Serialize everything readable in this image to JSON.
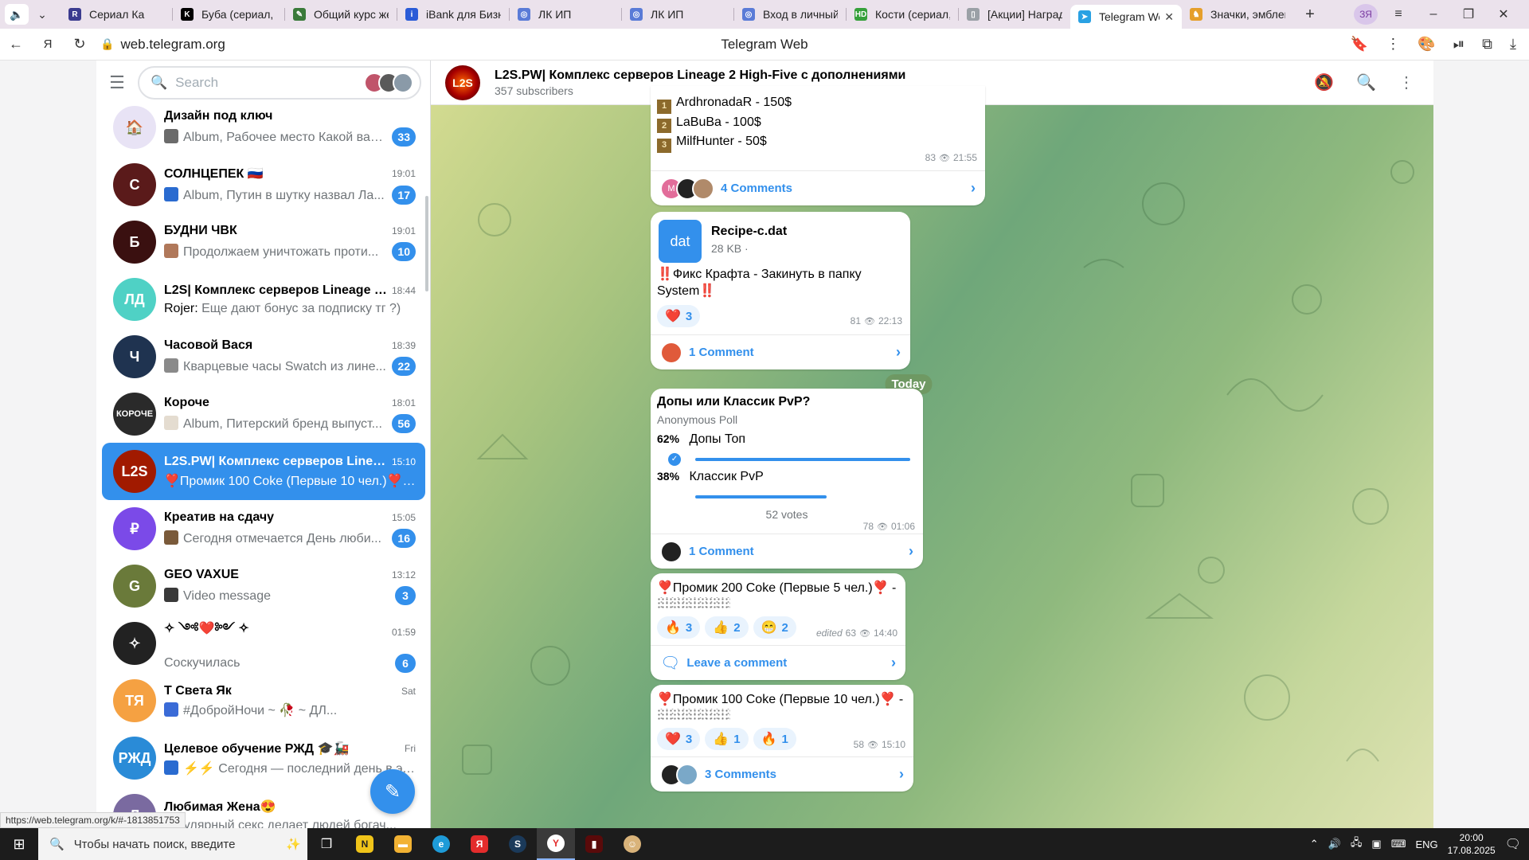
{
  "browser": {
    "tabs": [
      {
        "title": "Сериал Ка",
        "color": "#3b3b8f",
        "glyph": "R"
      },
      {
        "title": "Буба (сериал, в",
        "color": "#000000",
        "glyph": "K"
      },
      {
        "title": "Общий курс же",
        "color": "#3a7a3a",
        "glyph": "✎"
      },
      {
        "title": "iBank для Бизне",
        "color": "#2a5bd7",
        "glyph": "i"
      },
      {
        "title": "ЛК ИП",
        "color": "#5a7bd7",
        "glyph": "◎"
      },
      {
        "title": "ЛК ИП",
        "color": "#5a7bd7",
        "glyph": "◎"
      },
      {
        "title": "Вход в личный",
        "color": "#5a7bd7",
        "glyph": "◎"
      },
      {
        "title": "Кости (сериал,",
        "color": "#35a03a",
        "glyph": "HD"
      },
      {
        "title": "[Акции] Наград",
        "color": "#9aa0a6",
        "glyph": "▯"
      },
      {
        "title": "Telegram We",
        "color": "#2aa1e3",
        "glyph": "➤",
        "active": true
      },
      {
        "title": "Значки, эмблем",
        "color": "#e59f2b",
        "glyph": "♞"
      }
    ],
    "url": "web.telegram.org",
    "page_title": "Telegram Web",
    "status_url": "https://web.telegram.org/k/#-1813851753"
  },
  "sidebar": {
    "search_placeholder": "Search",
    "chats": [
      {
        "name": "Дизайн под ключ",
        "time": "",
        "preview": "Album, Рабочее место Какой вар...",
        "badge": "33",
        "color": "#e8e3f5",
        "initials": "🏠",
        "thumb": "#6b6b6b"
      },
      {
        "name": "СОЛНЦЕПЕК 🇷🇺",
        "time": "19:01",
        "preview": "Album, Путин в шутку назвал Ла...",
        "badge": "17",
        "color": "#5a1a1a",
        "initials": "С",
        "thumb": "#2a6bd0"
      },
      {
        "name": "БУДНИ ЧВК",
        "time": "19:01",
        "preview": "Продолжаем уничтожать проти...",
        "badge": "10",
        "color": "#3a1010",
        "initials": "Б",
        "thumb": "#b0785a"
      },
      {
        "name": "L2S| Комплекс серверов Lineage 2 ...",
        "time": "18:44",
        "sender": "Rojer:",
        "preview": " Еще дают бонус за подписку тг ?)",
        "badge": "",
        "color": "#4fd1c5",
        "initials": "ЛД",
        "thumb": ""
      },
      {
        "name": "Часовой Вася",
        "time": "18:39",
        "preview": "Кварцевые часы Swatch из лине...",
        "badge": "22",
        "color": "#1f3350",
        "initials": "Ч",
        "thumb": "#8a8a8a"
      },
      {
        "name": "Короче",
        "time": "18:01",
        "preview": "Album, Питерский бренд выпуст...",
        "badge": "56",
        "color": "#2a2a2a",
        "initials": "КОРОЧЕ",
        "thumb": "#e4dcd0"
      },
      {
        "name": "L2S.PW| Комплекс серверов Lineag...",
        "time": "15:10",
        "preview": "❣️Промик 100 Coke (Первые 10 чел.)❣️ -...",
        "badge": "",
        "color": "#a11a00",
        "initials": "L2S",
        "thumb": "",
        "active": true
      },
      {
        "name": "Креатив на сдачу",
        "time": "15:05",
        "preview": "Сегодня отмечается День люби...",
        "badge": "16",
        "color": "#7b4ae8",
        "initials": "₽",
        "thumb": "#7a5a3a"
      },
      {
        "name": "GEO VAXUE",
        "time": "13:12",
        "preview": "Video message",
        "badge": "3",
        "color": "#6a7a3a",
        "initials": "G",
        "thumb": "#3a3a3a"
      },
      {
        "name": "✧ ༺❤️༻ ✧",
        "time": "01:59",
        "preview": "Соскучилась",
        "badge": "6",
        "color": "#222222",
        "initials": "✧",
        "thumb": ""
      },
      {
        "name": "Т Света Як",
        "time": "Sat",
        "preview": "#ДобройНочи ~ 🥀 ~ ДЛ...",
        "badge": "",
        "color": "#f5a142",
        "initials": "ТЯ",
        "thumb": "#3a6bd7"
      },
      {
        "name": "Целевое обучение РЖД 🎓🚂",
        "time": "Fri",
        "preview": "⚡⚡ Сегодня — последний день в эт...",
        "badge": "",
        "color": "#2a8bd7",
        "initials": "РЖД",
        "thumb": "#2a6bd0"
      },
      {
        "name": "Любимая Жена😍",
        "time": "",
        "preview": "Регулярный секс делает людей богач...",
        "badge": "",
        "color": "#7a6aa0",
        "initials": "Л",
        "thumb": ""
      }
    ]
  },
  "chat": {
    "title": "L2S.PW| Комплекс серверов Lineage 2 High-Five с дополнениями",
    "subscribers": "357 subscribers",
    "msg1": {
      "lines": [
        {
          "rank": "1",
          "text": "ArdhronadaR - 150$"
        },
        {
          "rank": "2",
          "text": "LaBuBa - 100$"
        },
        {
          "rank": "3",
          "text": "MilfHunter - 50$"
        }
      ],
      "views": "83",
      "time": "21:55",
      "comments": "4 Comments"
    },
    "msg2": {
      "file_ext": "dat",
      "file_name": "Recipe-c.dat",
      "file_size": "28 KB ·",
      "text": "‼️Фикс Крафта - Закинуть в папку System‼️",
      "react_emoji": "❤️",
      "react_count": "3",
      "views": "81",
      "time": "22:13",
      "comments": "1 Comment"
    },
    "today_label": "Today",
    "poll": {
      "question": "Допы или Классик PvP?",
      "type": "Anonymous Poll",
      "options": [
        {
          "pct": "62%",
          "label": "Допы Топ",
          "value": 62
        },
        {
          "pct": "38%",
          "label": "Классик PvP",
          "value": 38
        }
      ],
      "votes": "52 votes",
      "views": "78",
      "time": "01:06",
      "comments": "1 Comment"
    },
    "msg4": {
      "text": "❣️Промик 200 Coke (Первые 5 чел.)❣️ -",
      "reactions": [
        {
          "emoji": "🔥",
          "count": "3"
        },
        {
          "emoji": "👍",
          "count": "2"
        },
        {
          "emoji": "😁",
          "count": "2"
        }
      ],
      "edited": "edited",
      "views": "63",
      "time": "14:40",
      "comments": "Leave a comment"
    },
    "msg5": {
      "text": "❣️Промик 100 Coke (Первые 10 чел.)❣️ -",
      "reactions": [
        {
          "emoji": "❤️",
          "count": "3"
        },
        {
          "emoji": "👍",
          "count": "1"
        },
        {
          "emoji": "🔥",
          "count": "1"
        }
      ],
      "views": "58",
      "time": "15:10",
      "comments": "3 Comments"
    }
  },
  "taskbar": {
    "search_placeholder": "Чтобы начать поиск, введите",
    "lang": "ENG",
    "time": "20:00",
    "date": "17.08.2025"
  }
}
